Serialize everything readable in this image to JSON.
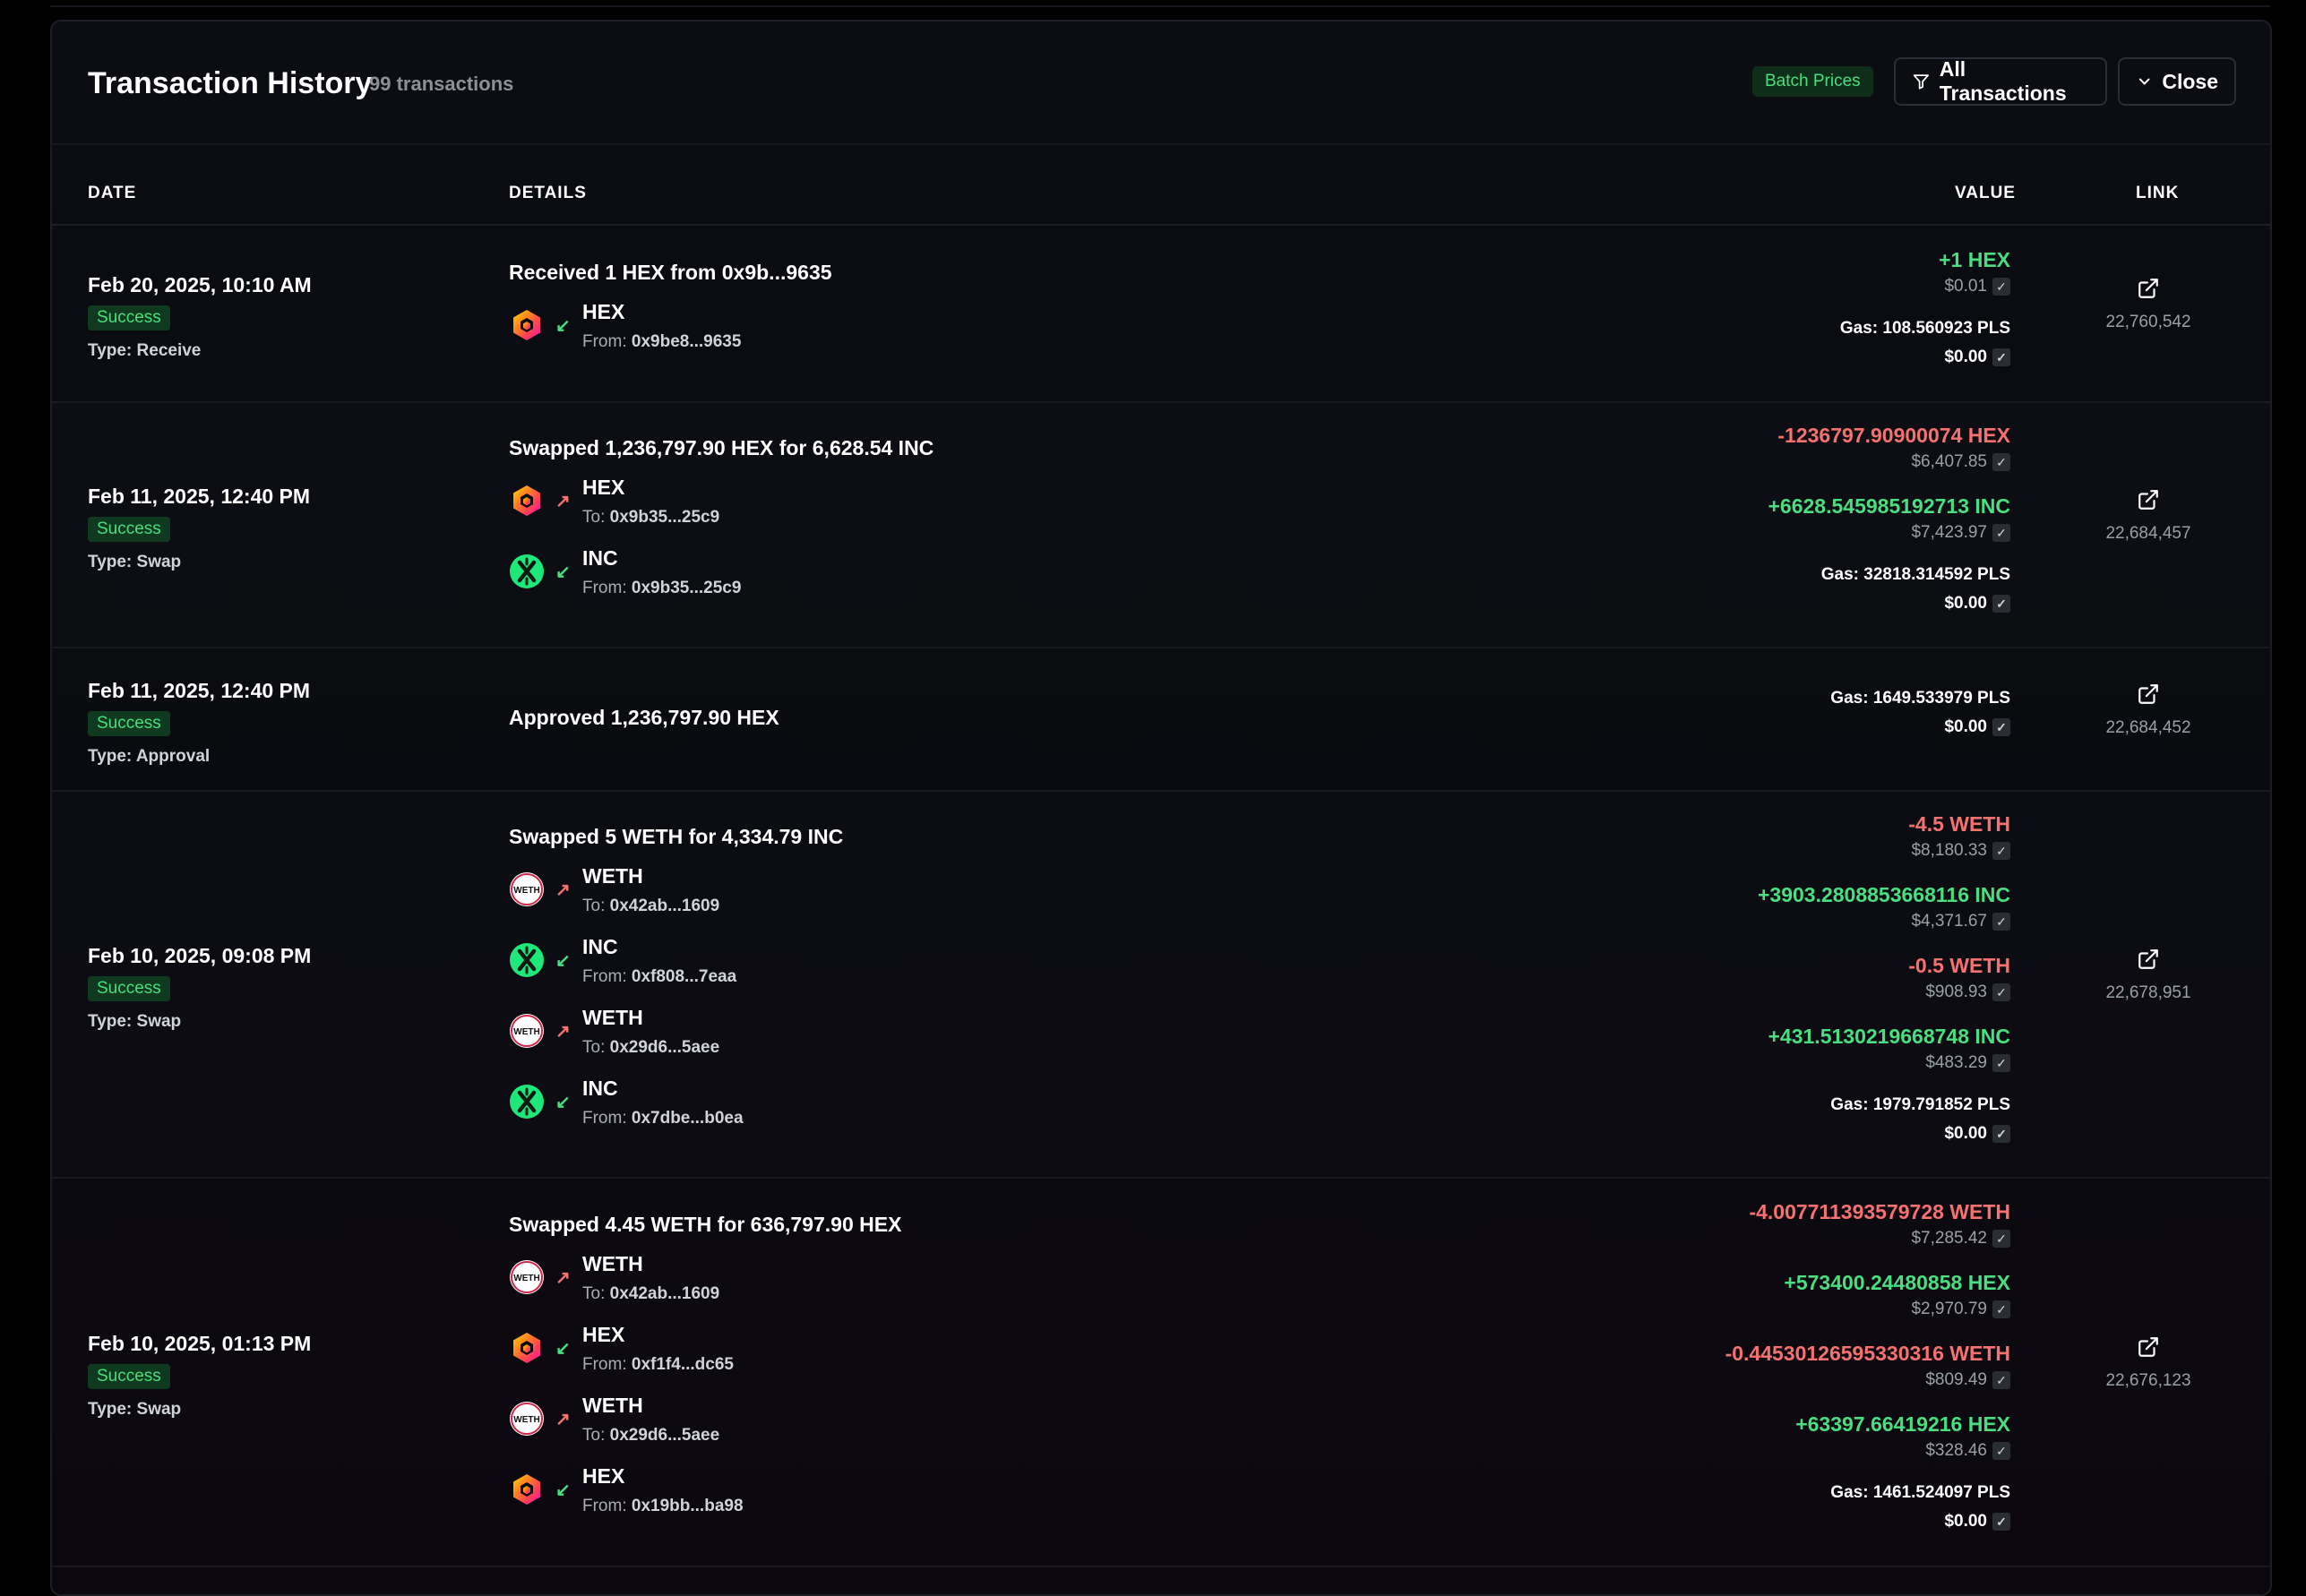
{
  "header": {
    "title": "Transaction History",
    "count": "99 transactions",
    "batch_label": "Batch Prices",
    "filter_label": "All Transactions",
    "close_label": "Close"
  },
  "columns": {
    "date": "DATE",
    "details": "DETAILS",
    "value": "VALUE",
    "link": "LINK"
  },
  "transactions": [
    {
      "date": "Feb 20, 2025, 10:10 AM",
      "status": "Success",
      "type": "Type: Receive",
      "summary": "Received 1 HEX from 0x9b...9635",
      "legs": [
        {
          "token": "HEX",
          "dir": "in",
          "label": "From:",
          "addr": "0x9be8...9635"
        }
      ],
      "values": [
        {
          "amount": "+1 HEX",
          "sign": "pos",
          "usd": "$0.01"
        }
      ],
      "gas": "Gas: 108.560923 PLS",
      "gas_usd": "$0.00",
      "block": "22,760,542"
    },
    {
      "date": "Feb 11, 2025, 12:40 PM",
      "status": "Success",
      "type": "Type: Swap",
      "summary": "Swapped 1,236,797.90 HEX for 6,628.54 INC",
      "legs": [
        {
          "token": "HEX",
          "dir": "out",
          "label": "To:",
          "addr": "0x9b35...25c9"
        },
        {
          "token": "INC",
          "dir": "in",
          "label": "From:",
          "addr": "0x9b35...25c9"
        }
      ],
      "values": [
        {
          "amount": "-1236797.90900074 HEX",
          "sign": "neg",
          "usd": "$6,407.85"
        },
        {
          "amount": "+6628.545985192713 INC",
          "sign": "pos",
          "usd": "$7,423.97"
        }
      ],
      "gas": "Gas: 32818.314592 PLS",
      "gas_usd": "$0.00",
      "block": "22,684,457"
    },
    {
      "date": "Feb 11, 2025, 12:40 PM",
      "status": "Success",
      "type": "Type: Approval",
      "summary": "Approved 1,236,797.90 HEX",
      "legs": [],
      "values": [],
      "gas": "Gas: 1649.533979 PLS",
      "gas_usd": "$0.00",
      "block": "22,684,452"
    },
    {
      "date": "Feb 10, 2025, 09:08 PM",
      "status": "Success",
      "type": "Type: Swap",
      "summary": "Swapped 5 WETH for 4,334.79 INC",
      "legs": [
        {
          "token": "WETH",
          "dir": "out",
          "label": "To:",
          "addr": "0x42ab...1609"
        },
        {
          "token": "INC",
          "dir": "in",
          "label": "From:",
          "addr": "0xf808...7eaa"
        },
        {
          "token": "WETH",
          "dir": "out",
          "label": "To:",
          "addr": "0x29d6...5aee"
        },
        {
          "token": "INC",
          "dir": "in",
          "label": "From:",
          "addr": "0x7dbe...b0ea"
        }
      ],
      "values": [
        {
          "amount": "-4.5 WETH",
          "sign": "neg",
          "usd": "$8,180.33"
        },
        {
          "amount": "+3903.2808853668116 INC",
          "sign": "pos",
          "usd": "$4,371.67"
        },
        {
          "amount": "-0.5 WETH",
          "sign": "neg",
          "usd": "$908.93"
        },
        {
          "amount": "+431.5130219668748 INC",
          "sign": "pos",
          "usd": "$483.29"
        }
      ],
      "gas": "Gas: 1979.791852 PLS",
      "gas_usd": "$0.00",
      "block": "22,678,951"
    },
    {
      "date": "Feb 10, 2025, 01:13 PM",
      "status": "Success",
      "type": "Type: Swap",
      "summary": "Swapped 4.45 WETH for 636,797.90 HEX",
      "legs": [
        {
          "token": "WETH",
          "dir": "out",
          "label": "To:",
          "addr": "0x42ab...1609"
        },
        {
          "token": "HEX",
          "dir": "in",
          "label": "From:",
          "addr": "0xf1f4...dc65"
        },
        {
          "token": "WETH",
          "dir": "out",
          "label": "To:",
          "addr": "0x29d6...5aee"
        },
        {
          "token": "HEX",
          "dir": "in",
          "label": "From:",
          "addr": "0x19bb...ba98"
        }
      ],
      "values": [
        {
          "amount": "-4.007711393579728 WETH",
          "sign": "neg",
          "usd": "$7,285.42"
        },
        {
          "amount": "+573400.24480858 HEX",
          "sign": "pos",
          "usd": "$2,970.79"
        },
        {
          "amount": "-0.44530126595330316 WETH",
          "sign": "neg",
          "usd": "$809.49"
        },
        {
          "amount": "+63397.66419216 HEX",
          "sign": "pos",
          "usd": "$328.46"
        }
      ],
      "gas": "Gas: 1461.524097 PLS",
      "gas_usd": "$0.00",
      "block": "22,676,123"
    }
  ],
  "icons": {
    "hex": "hex-token-icon",
    "inc": "inc-token-icon",
    "weth": "weth-token-icon",
    "weth_text": "WETH",
    "link": "external-link-icon"
  },
  "colors": {
    "positive": "#4ade80",
    "negative": "#f87171",
    "badge_bg": "#0f3a1f"
  }
}
